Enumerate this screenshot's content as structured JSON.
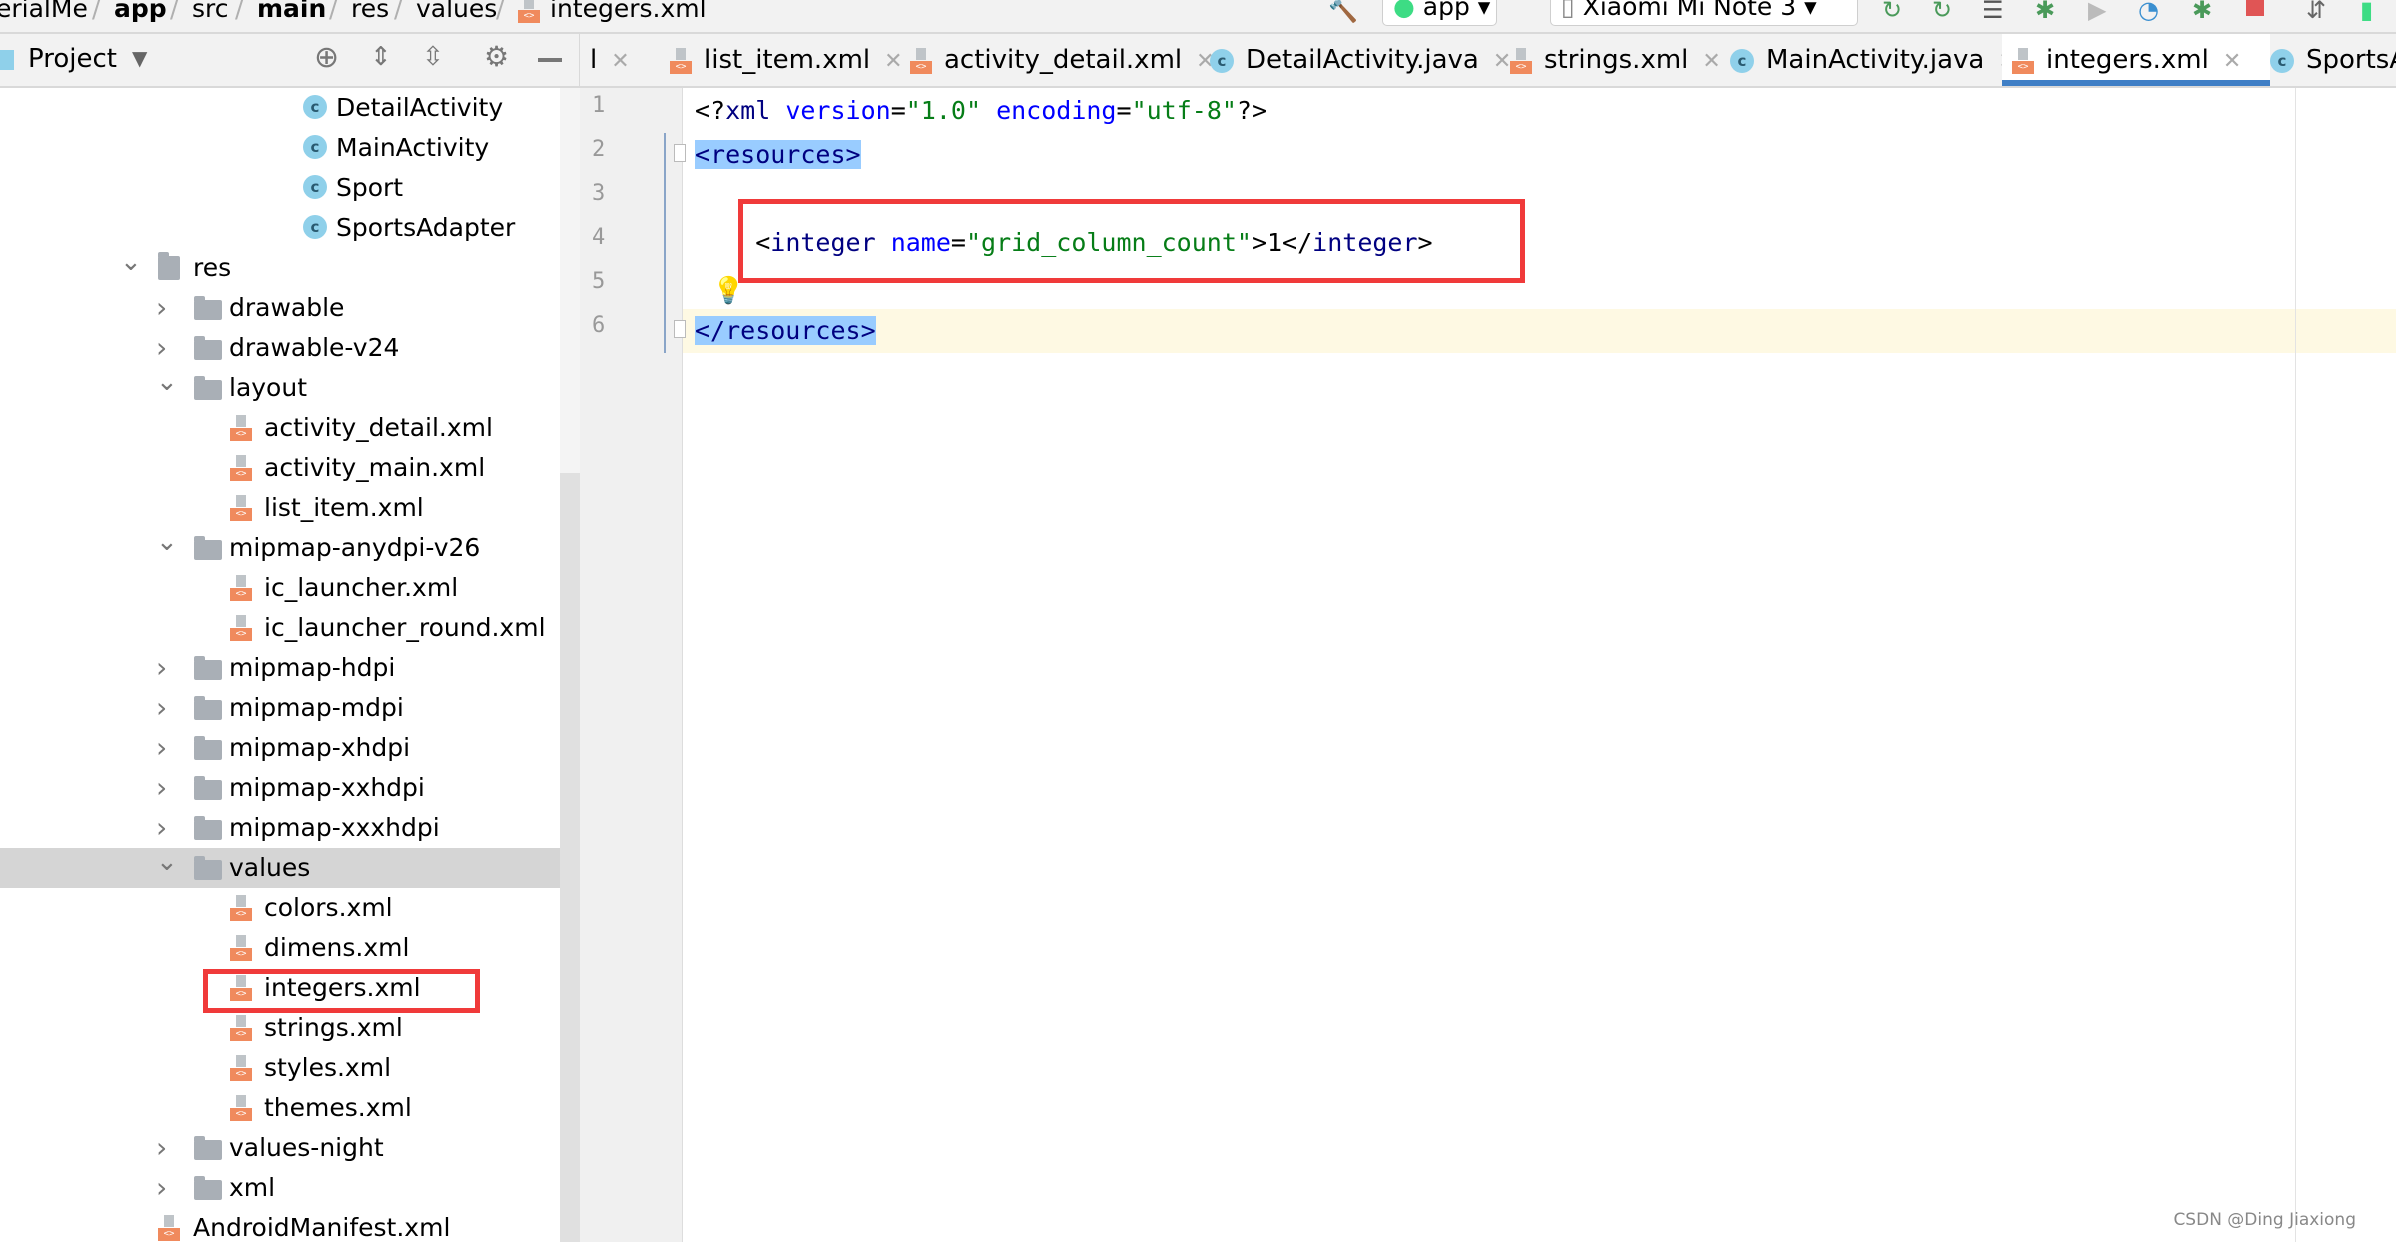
{
  "breadcrumb": [
    "erialMe",
    "app",
    "src",
    "main",
    "res",
    "values",
    "integers.xml"
  ],
  "toolbar": {
    "run_config": "app",
    "device": "Xiaomi Mi Note 3",
    "icons": [
      "hammer-icon",
      "run-config-dropdown",
      "device-dropdown",
      "apply-changes-icon",
      "apply-code-changes-icon",
      "logcat-icon",
      "debug-icon",
      "attach-icon",
      "profiler-icon",
      "attach-debugger-icon",
      "stop-icon",
      "sync-icon",
      "avd-icon"
    ]
  },
  "tool_window": {
    "title": "Project"
  },
  "tabs": [
    {
      "label": "l",
      "icon": "xml"
    },
    {
      "label": "list_item.xml",
      "icon": "xml"
    },
    {
      "label": "activity_detail.xml",
      "icon": "xml"
    },
    {
      "label": "DetailActivity.java",
      "icon": "class"
    },
    {
      "label": "strings.xml",
      "icon": "xml"
    },
    {
      "label": "MainActivity.java",
      "icon": "class"
    },
    {
      "label": "integers.xml",
      "icon": "xml",
      "active": true
    },
    {
      "label": "SportsAc",
      "icon": "class"
    }
  ],
  "tree": [
    {
      "label": "DetailActivity",
      "type": "class",
      "depth": 3
    },
    {
      "label": "MainActivity",
      "type": "class",
      "depth": 3
    },
    {
      "label": "Sport",
      "type": "class",
      "depth": 3
    },
    {
      "label": "SportsAdapter",
      "type": "class",
      "depth": 3
    },
    {
      "label": "res",
      "type": "res",
      "depth": 1,
      "expanded": true
    },
    {
      "label": "drawable",
      "type": "folder",
      "depth": 2,
      "expanded": false
    },
    {
      "label": "drawable-v24",
      "type": "folder",
      "depth": 2,
      "expanded": false
    },
    {
      "label": "layout",
      "type": "folder",
      "depth": 2,
      "expanded": true
    },
    {
      "label": "activity_detail.xml",
      "type": "xml",
      "depth": 3
    },
    {
      "label": "activity_main.xml",
      "type": "xml",
      "depth": 3
    },
    {
      "label": "list_item.xml",
      "type": "xml",
      "depth": 3
    },
    {
      "label": "mipmap-anydpi-v26",
      "type": "folder",
      "depth": 2,
      "expanded": true
    },
    {
      "label": "ic_launcher.xml",
      "type": "xml",
      "depth": 3
    },
    {
      "label": "ic_launcher_round.xml",
      "type": "xml",
      "depth": 3
    },
    {
      "label": "mipmap-hdpi",
      "type": "folder",
      "depth": 2,
      "expanded": false
    },
    {
      "label": "mipmap-mdpi",
      "type": "folder",
      "depth": 2,
      "expanded": false
    },
    {
      "label": "mipmap-xhdpi",
      "type": "folder",
      "depth": 2,
      "expanded": false
    },
    {
      "label": "mipmap-xxhdpi",
      "type": "folder",
      "depth": 2,
      "expanded": false
    },
    {
      "label": "mipmap-xxxhdpi",
      "type": "folder",
      "depth": 2,
      "expanded": false
    },
    {
      "label": "values",
      "type": "folder",
      "depth": 2,
      "expanded": true,
      "selected": true
    },
    {
      "label": "colors.xml",
      "type": "xml",
      "depth": 3
    },
    {
      "label": "dimens.xml",
      "type": "xml",
      "depth": 3
    },
    {
      "label": "integers.xml",
      "type": "xml",
      "depth": 3,
      "highlighted": true
    },
    {
      "label": "strings.xml",
      "type": "xml",
      "depth": 3
    },
    {
      "label": "styles.xml",
      "type": "xml",
      "depth": 3
    },
    {
      "label": "themes.xml",
      "type": "xml",
      "depth": 3
    },
    {
      "label": "values-night",
      "type": "folder",
      "depth": 2,
      "expanded": false
    },
    {
      "label": "xml",
      "type": "folder",
      "depth": 2,
      "expanded": false
    },
    {
      "label": "AndroidManifest.xml",
      "type": "manifest",
      "depth": 1
    }
  ],
  "editor": {
    "lines": [
      [
        [
          "plain",
          "<?"
        ],
        [
          "tag",
          "xml "
        ],
        [
          "attr",
          "version"
        ],
        [
          "plain",
          "="
        ],
        [
          "str",
          "\"1.0\""
        ],
        [
          "plain",
          " "
        ],
        [
          "attr",
          "encoding"
        ],
        [
          "plain",
          "="
        ],
        [
          "str",
          "\"utf-8\""
        ],
        [
          "plain",
          "?>"
        ]
      ],
      [
        [
          "hlt",
          "<resources>"
        ]
      ],
      [],
      [
        [
          "plain",
          "    <"
        ],
        [
          "tag",
          "integer "
        ],
        [
          "attr",
          "name"
        ],
        [
          "plain",
          "="
        ],
        [
          "str",
          "\"grid_column_count\""
        ],
        [
          "plain",
          ">1</"
        ],
        [
          "tag",
          "integer"
        ],
        [
          "plain",
          ">"
        ]
      ],
      [],
      [
        [
          "hlt",
          "</resources>"
        ]
      ]
    ]
  },
  "colors": {
    "highlight": "#f03a3a",
    "active_tab": "#3f7fc6",
    "xml_icon": "#f08a5d"
  },
  "watermark": "CSDN @Ding Jiaxiong"
}
